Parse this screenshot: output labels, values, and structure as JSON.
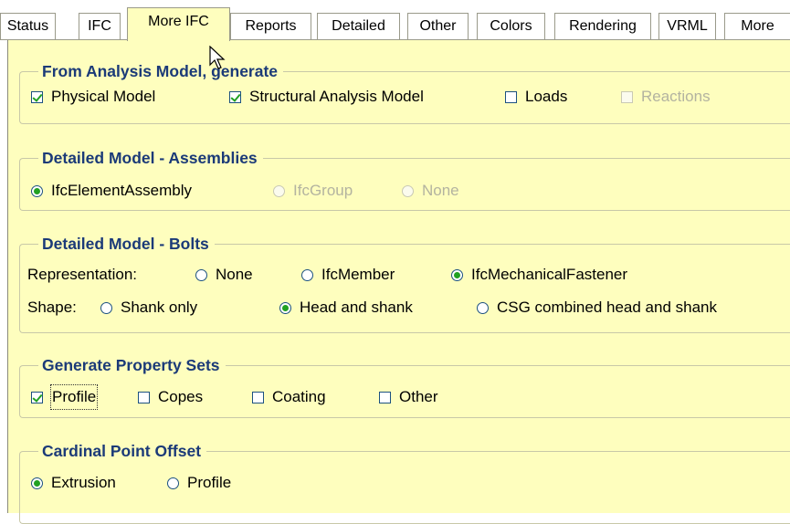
{
  "tabs": [
    {
      "label": "Status",
      "active": false
    },
    {
      "label": "IFC",
      "active": false
    },
    {
      "label": "More IFC",
      "active": true
    },
    {
      "label": "Reports",
      "active": false
    },
    {
      "label": "Detailed",
      "active": false
    },
    {
      "label": "Other",
      "active": false
    },
    {
      "label": "Colors",
      "active": false
    },
    {
      "label": "Rendering",
      "active": false
    },
    {
      "label": "VRML",
      "active": false
    },
    {
      "label": "More",
      "active": false
    }
  ],
  "analysis_group": {
    "title": "From Analysis Model, generate",
    "options": [
      {
        "label": "Physical Model",
        "checked": true,
        "enabled": true
      },
      {
        "label": "Structural Analysis Model",
        "checked": true,
        "enabled": true
      },
      {
        "label": "Loads",
        "checked": false,
        "enabled": true
      },
      {
        "label": "Reactions",
        "checked": false,
        "enabled": false
      }
    ]
  },
  "assemblies_group": {
    "title": "Detailed Model - Assemblies",
    "options": [
      {
        "label": "IfcElementAssembly",
        "selected": true,
        "enabled": true
      },
      {
        "label": "IfcGroup",
        "selected": false,
        "enabled": false
      },
      {
        "label": "None",
        "selected": false,
        "enabled": false
      }
    ]
  },
  "bolts_group": {
    "title": "Detailed Model - Bolts",
    "representation_label": "Representation:",
    "representation_options": [
      {
        "label": "None",
        "selected": false
      },
      {
        "label": "IfcMember",
        "selected": false
      },
      {
        "label": "IfcMechanicalFastener",
        "selected": true
      }
    ],
    "shape_label": "Shape:",
    "shape_options": [
      {
        "label": "Shank only",
        "selected": false
      },
      {
        "label": "Head and shank",
        "selected": true
      },
      {
        "label": "CSG combined head and shank",
        "selected": false
      }
    ]
  },
  "property_sets_group": {
    "title": "Generate Property Sets",
    "options": [
      {
        "label": "Profile",
        "checked": true
      },
      {
        "label": "Copes",
        "checked": false
      },
      {
        "label": "Coating",
        "checked": false
      },
      {
        "label": "Other",
        "checked": false
      }
    ]
  },
  "cardinal_group": {
    "title": "Cardinal Point Offset",
    "options": [
      {
        "label": "Extrusion",
        "selected": true
      },
      {
        "label": "Profile",
        "selected": false
      }
    ]
  },
  "colors": {
    "panel_bg": "#fefebe",
    "group_title": "#1b3a78",
    "check_mark": "#21a121"
  }
}
